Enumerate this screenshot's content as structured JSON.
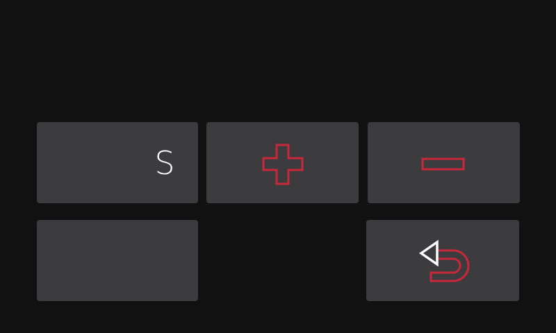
{
  "keypad": {
    "keys": [
      {
        "id": "s",
        "label": "S",
        "icon": null
      },
      {
        "id": "plus",
        "label": "",
        "icon": "plus-icon"
      },
      {
        "id": "minus",
        "label": "",
        "icon": "minus-icon"
      },
      {
        "id": "blank",
        "label": "",
        "icon": null
      },
      {
        "id": "back",
        "label": "",
        "icon": "back-arrow-icon"
      }
    ]
  },
  "colors": {
    "background": "#111111",
    "key_fill": "#3c3c3f",
    "icon_accent": "#c8283a",
    "icon_white": "#ffffff",
    "letter": "#ffffff"
  }
}
